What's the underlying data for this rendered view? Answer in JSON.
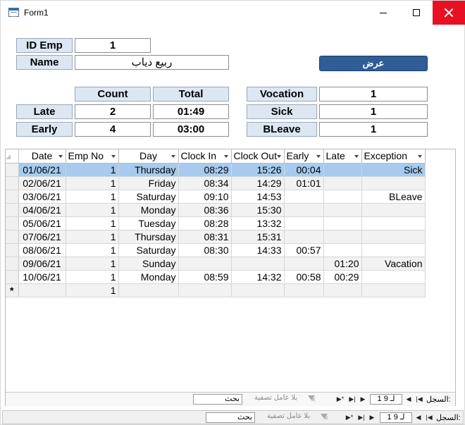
{
  "window": {
    "title": "Form1"
  },
  "header": {
    "id_label": "ID Emp",
    "id_value": "1",
    "name_label": "Name",
    "name_value": "ربيع دياب",
    "show_button": "عرض"
  },
  "summary": {
    "count_header": "Count",
    "total_header": "Total",
    "late_label": "Late",
    "late_count": "2",
    "late_total": "01:49",
    "early_label": "Early",
    "early_count": "4",
    "early_total": "03:00",
    "vocation_label": "Vocation",
    "vocation_value": "1",
    "sick_label": "Sick",
    "sick_value": "1",
    "bleave_label": "BLeave",
    "bleave_value": "1"
  },
  "grid": {
    "columns": [
      "Date",
      "Emp No",
      "Day",
      "Clock In",
      "Clock Out",
      "Early",
      "Late",
      "Exception"
    ],
    "rows": [
      [
        "01/06/21",
        "1",
        "Thursday",
        "08:29",
        "15:26",
        "00:04",
        "",
        "Sick"
      ],
      [
        "02/06/21",
        "1",
        "Friday",
        "08:34",
        "14:29",
        "01:01",
        "",
        ""
      ],
      [
        "03/06/21",
        "1",
        "Saturday",
        "09:10",
        "14:53",
        "",
        "",
        "BLeave"
      ],
      [
        "04/06/21",
        "1",
        "Monday",
        "08:36",
        "15:30",
        "",
        "",
        ""
      ],
      [
        "05/06/21",
        "1",
        "Tuesday",
        "08:28",
        "13:32",
        "",
        "",
        ""
      ],
      [
        "07/06/21",
        "1",
        "Thursday",
        "08:31",
        "15:31",
        "",
        "",
        ""
      ],
      [
        "08/06/21",
        "1",
        "Saturday",
        "08:30",
        "14:33",
        "00:57",
        "",
        ""
      ],
      [
        "09/06/21",
        "1",
        "Sunday",
        "",
        "",
        "",
        "01:20",
        "Vacation"
      ],
      [
        "10/06/21",
        "1",
        "Monday",
        "08:59",
        "14:32",
        "00:58",
        "00:29",
        ""
      ]
    ],
    "new_row_marker": "*",
    "new_row_emp": "1"
  },
  "subform_nav": {
    "record_label": "السجل:",
    "position": "1 لـ 9",
    "filter": "بلا عامل تصفية",
    "search": "بحث"
  },
  "form_nav": {
    "record_label": "السجل:",
    "position": "1 لـ 9",
    "filter": "بلا عامل تصفية",
    "search": "بحث"
  }
}
